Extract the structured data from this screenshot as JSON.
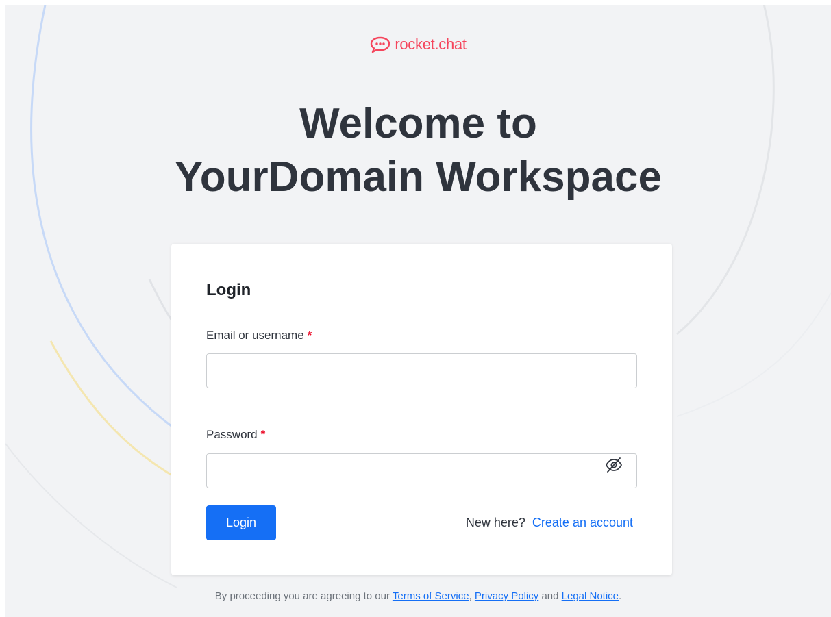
{
  "brand": {
    "name": "rocket.chat",
    "icon": "rocket-chat-logo-icon",
    "color": "#f5455c"
  },
  "headline": {
    "line1": "Welcome to",
    "line2": "YourDomain Workspace"
  },
  "login_form": {
    "title": "Login",
    "email": {
      "label": "Email or username",
      "required_mark": "*",
      "value": "",
      "placeholder": ""
    },
    "password": {
      "label": "Password",
      "required_mark": "*",
      "value": "",
      "placeholder": "",
      "toggle_icon": "eye-off-icon"
    },
    "submit_label": "Login",
    "new_here": "New here?",
    "create_account": "Create an account"
  },
  "legal": {
    "prefix": "By proceeding you are agreeing to our",
    "terms": "Terms of Service",
    "sep1": ",",
    "privacy": "Privacy Policy",
    "and": "and",
    "notice": "Legal Notice",
    "end": "."
  },
  "colors": {
    "primary": "#156ff5",
    "background": "#f2f3f5",
    "required": "#ec0d2a"
  }
}
